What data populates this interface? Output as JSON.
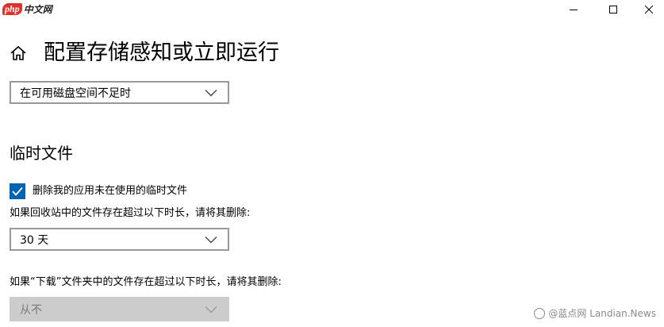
{
  "watermark": {
    "logo_php": "php",
    "logo_cn": "中文网"
  },
  "window": {
    "minimize_icon": "minimize-icon",
    "maximize_icon": "maximize-icon",
    "close_icon": "close-icon"
  },
  "page": {
    "title": "配置存储感知或立即运行",
    "home_icon": "home-icon"
  },
  "run_dropdown": {
    "value": "在可用磁盘空间不足时"
  },
  "temp_files": {
    "heading": "临时文件",
    "delete_unused": {
      "label": "删除我的应用未在使用的临时文件",
      "checked": true
    },
    "recycle_label": "如果回收站中的文件存在超过以下时长，请将其删除:",
    "recycle_value": "30 天",
    "downloads_label": "如果“下载”文件夹中的文件存在超过以下时长，请将其删除:",
    "downloads_value": "从不"
  },
  "site_watermark": {
    "text": "@蓝点网 Landian.News"
  },
  "colors": {
    "accent": "#0063b1",
    "border": "#999999",
    "disabled_bg": "#cccccc"
  }
}
